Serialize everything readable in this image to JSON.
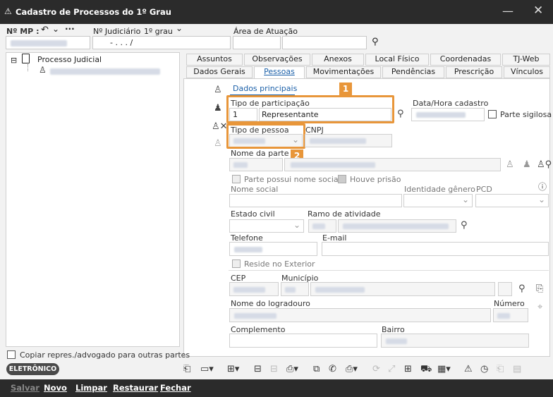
{
  "window": {
    "title": "Cadastro de Processos do 1º Grau",
    "minimize_glyph": "—",
    "close_glyph": "✕"
  },
  "header": {
    "mp_label": "Nº MP :",
    "judiciario_label": "Nº Judiciário",
    "grau_label": "1º grau",
    "judiciario_mask": "-    .    .   .   /",
    "area_label": "Área de Atuação"
  },
  "tree": {
    "root_label": "Processo Judicial",
    "expand_glyph": "⊟"
  },
  "tabs_row1": [
    "Assuntos",
    "Observações",
    "Anexos",
    "Local Físico",
    "Coordenadas",
    "TJ-Web"
  ],
  "tabs_row2": [
    "Dados Gerais",
    "Pessoas",
    "Movimentações",
    "Pendências",
    "Prescrição",
    "Vínculos"
  ],
  "subtab": "Dados principais",
  "form": {
    "tipo_participacao_label": "Tipo de participação",
    "tipo_participacao_code": "1",
    "tipo_participacao_value": "Representante",
    "data_hora_label": "Data/Hora cadastro",
    "parte_sigilosa_label": "Parte sigilosa",
    "tipo_pessoa_label": "Tipo de pessoa",
    "cnpj_label": "CNPJ",
    "nome_parte_label": "Nome da parte",
    "nome_social_check_label": "Parte possui nome social",
    "houve_prisao_label": "Houve prisão",
    "nome_social_label": "Nome social",
    "identidade_genero_label": "Identidade gênero",
    "pcd_label": "PCD",
    "estado_civil_label": "Estado civil",
    "ramo_atividade_label": "Ramo de atividade",
    "telefone_label": "Telefone",
    "email_label": "E-mail",
    "reside_exterior_label": "Reside no Exterior",
    "cep_label": "CEP",
    "municipio_label": "Município",
    "logradouro_label": "Nome do logradouro",
    "numero_label": "Número",
    "complemento_label": "Complemento",
    "bairro_label": "Bairro"
  },
  "callouts": {
    "one": "1",
    "two": "2"
  },
  "footer": {
    "copiar_label": "Copiar repres./advogado para outras partes",
    "badge": "ELETRÔNICO"
  },
  "actions": {
    "salvar": "Salvar",
    "novo": "Novo",
    "limpar": "Limpar",
    "restaurar": "Restaurar",
    "fechar": "Fechar"
  },
  "colors": {
    "titlebar": "#2b2b2b",
    "highlight": "#e8963a",
    "active_tab_text": "#1a5fa8"
  }
}
